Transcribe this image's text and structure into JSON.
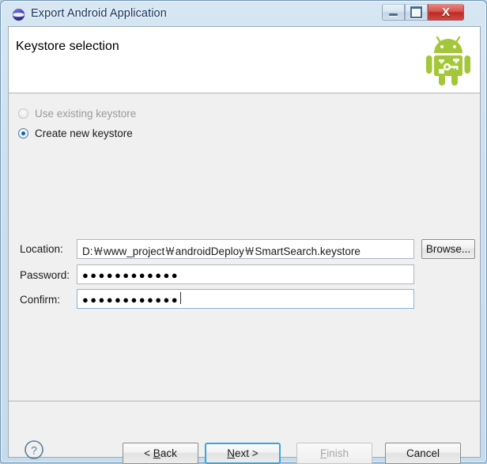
{
  "window": {
    "title": "Export Android Application",
    "icon": "eclipse-icon",
    "controls": {
      "minimize": "–",
      "maximize": "□",
      "close": "X"
    }
  },
  "header": {
    "title": "Keystore selection",
    "logo": "android-robot-keystore-icon"
  },
  "form": {
    "radios": [
      {
        "label": "Use existing keystore",
        "selected": false,
        "enabled": false
      },
      {
        "label": "Create new keystore",
        "selected": true,
        "enabled": true
      }
    ],
    "fields": [
      {
        "label": "Location:",
        "value": "D:￦www_project￦androidDeploy￦SmartSearch.keystore",
        "masked": false,
        "focused": false
      },
      {
        "label": "Password:",
        "value": "●●●●●●●●●●●●",
        "masked": true,
        "focused": false,
        "dot_count": 12
      },
      {
        "label": "Confirm:",
        "value": "●●●●●●●●●●●●",
        "masked": true,
        "focused": true,
        "dot_count": 12
      }
    ],
    "browse_label": "Browse..."
  },
  "footer": {
    "help_label": "?",
    "buttons": [
      {
        "name": "back",
        "prefix": "< ",
        "mnemonic": "B",
        "suffix": "ack",
        "enabled": true,
        "default": false
      },
      {
        "name": "next",
        "prefix": "",
        "mnemonic": "N",
        "suffix": "ext >",
        "enabled": true,
        "default": true
      },
      {
        "name": "finish",
        "prefix": "",
        "mnemonic": "F",
        "suffix": "inish",
        "enabled": false,
        "default": false
      },
      {
        "name": "cancel",
        "prefix": "",
        "mnemonic": "",
        "suffix": "Cancel",
        "enabled": true,
        "default": false
      }
    ]
  },
  "colors": {
    "android_green": "#A4C639",
    "focus_blue": "#3BA4E0",
    "radio_blue": "#14639C",
    "title_text": "#15335C",
    "close_red": "#BC2A24",
    "panel_bg": "#F0F0F0"
  }
}
